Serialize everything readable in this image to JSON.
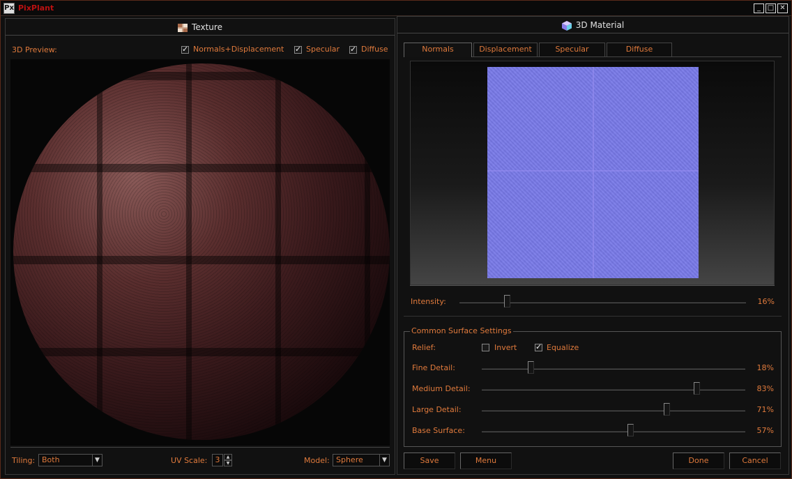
{
  "app": {
    "title": "PixPlant",
    "logo_text": "Px"
  },
  "window_controls": {
    "minimize": "_",
    "maximize": "□",
    "close": "✕"
  },
  "texture_panel": {
    "title": "Texture",
    "preview_label": "3D Preview:",
    "checks": [
      {
        "label": "Normals+Displacement",
        "checked": true
      },
      {
        "label": "Specular",
        "checked": true
      },
      {
        "label": "Diffuse",
        "checked": true
      }
    ],
    "tiling_label": "Tiling:",
    "tiling_value": "Both",
    "uv_scale_label": "UV Scale:",
    "uv_scale_value": "3",
    "model_label": "Model:",
    "model_value": "Sphere"
  },
  "material_panel": {
    "title": "3D Material",
    "tabs": [
      "Normals",
      "Displacement",
      "Specular",
      "Diffuse"
    ],
    "active_tab": "Normals",
    "intensity": {
      "label": "Intensity:",
      "value": 16,
      "display": "16%"
    },
    "common": {
      "title": "Common Surface Settings",
      "relief_label": "Relief:",
      "invert": {
        "label": "Invert",
        "checked": false
      },
      "equalize": {
        "label": "Equalize",
        "checked": true
      },
      "sliders": [
        {
          "label": "Fine Detail:",
          "value": 18,
          "display": "18%"
        },
        {
          "label": "Medium Detail:",
          "value": 83,
          "display": "83%"
        },
        {
          "label": "Large Detail:",
          "value": 71,
          "display": "71%"
        },
        {
          "label": "Base Surface:",
          "value": 57,
          "display": "57%"
        }
      ]
    },
    "buttons": {
      "save": "Save",
      "menu": "Menu",
      "done": "Done",
      "cancel": "Cancel"
    }
  },
  "colors": {
    "accent": "#e07a3c",
    "title_red": "#bb1111",
    "normal_map": "#7a7be8"
  }
}
